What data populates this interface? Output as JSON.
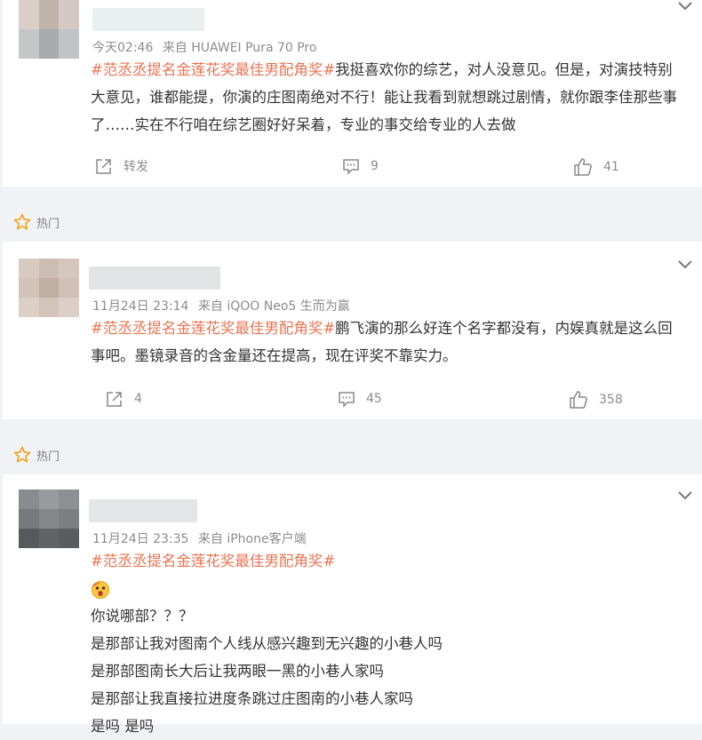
{
  "colors": {
    "tag": "#eb7350",
    "meta": "#8c8c8c",
    "background": "#f1f2f5"
  },
  "hot_label": "热门",
  "comments": [
    {
      "time": "今天02:46",
      "source": "来自 HUAWEI Pura 70 Pro",
      "tag": "#范丞丞提名金莲花奖最佳男配角奖#",
      "text": "我挺喜欢你的综艺，对人没意见。但是，对演技特别大意见，谁都能提，你演的庄图南绝对不行！能让我看到就想跳过剧情，就你跟李佳那些事了……实在不行咱在综艺圈好好呆着，专业的事交给专业的人去做",
      "repost": "转发",
      "comments_count": "9",
      "likes": "41"
    },
    {
      "time": "11月24日 23:14",
      "source": "来自 iQOO Neo5 生而为赢",
      "tag": "#范丞丞提名金莲花奖最佳男配角奖#",
      "text": "鹏飞演的那么好连个名字都没有，内娱真就是这么回事吧。墨镜录音的含金量还在提高，现在评奖不靠实力。",
      "repost": "4",
      "comments_count": "45",
      "likes": "358"
    },
    {
      "time": "11月24日 23:35",
      "source": "来自 iPhone客户端",
      "tag": "#范丞丞提名金莲花奖最佳男配角奖#",
      "lines": [
        "你说哪部？？？",
        "是那部让我对图南个人线从感兴趣到无兴趣的小巷人吗",
        "是那部图南长大后让我两眼一黑的小巷人家吗",
        "是那部让我直接拉进度条跳过庄图南的小巷人家吗",
        "是吗 是吗"
      ]
    }
  ]
}
